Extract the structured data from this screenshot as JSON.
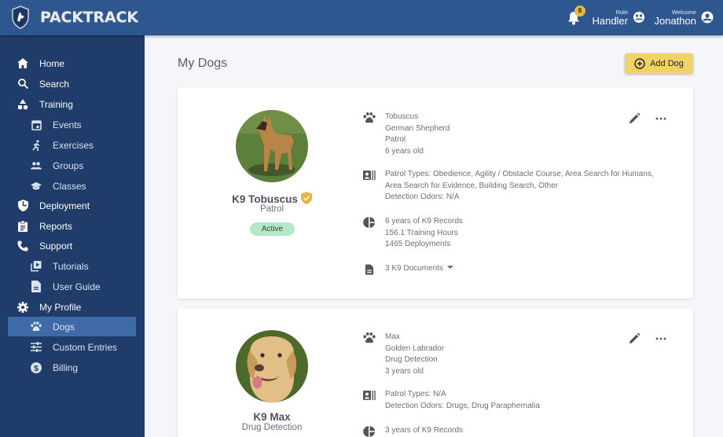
{
  "app": {
    "name": "PACKTRACK",
    "notifications_count": "8",
    "role_label": "Role",
    "role_value": "Handler",
    "welcome_label": "Welcome",
    "user_name": "Jonathon"
  },
  "sidebar": {
    "items": [
      {
        "label": "Home",
        "icon": "home-icon",
        "level": "top"
      },
      {
        "label": "Search",
        "icon": "search-icon",
        "level": "top"
      },
      {
        "label": "Training",
        "icon": "shapes-icon",
        "level": "top"
      },
      {
        "label": "Events",
        "icon": "calendar-icon",
        "level": "sub"
      },
      {
        "label": "Exercises",
        "icon": "running-icon",
        "level": "sub"
      },
      {
        "label": "Groups",
        "icon": "group-icon",
        "level": "sub"
      },
      {
        "label": "Classes",
        "icon": "graduation-cap-icon",
        "level": "sub"
      },
      {
        "label": "Deployment",
        "icon": "shield-icon",
        "level": "top"
      },
      {
        "label": "Reports",
        "icon": "clipboard-icon",
        "level": "top"
      },
      {
        "label": "Support",
        "icon": "phone-icon",
        "level": "top"
      },
      {
        "label": "Tutorials",
        "icon": "video-library-icon",
        "level": "sub"
      },
      {
        "label": "User Guide",
        "icon": "document-icon",
        "level": "sub"
      },
      {
        "label": "My Profile",
        "icon": "gear-icon",
        "level": "top"
      },
      {
        "label": "Dogs",
        "icon": "paw-icon",
        "level": "sub",
        "active": true
      },
      {
        "label": "Custom Entries",
        "icon": "sliders-icon",
        "level": "sub"
      },
      {
        "label": "Billing",
        "icon": "dollar-icon",
        "level": "sub"
      }
    ]
  },
  "main": {
    "title": "My Dogs",
    "add_button": "Add Dog",
    "dogs": [
      {
        "display_name": "K9 Tobuscus",
        "verified": true,
        "role": "Patrol",
        "status": "Active",
        "basic": [
          "Tobuscus",
          "German Shepherd",
          "Patrol",
          "6 years old"
        ],
        "types": [
          "Patrol Types: Obedience, Agility / Obstacle Course, Area Search for Humans,",
          "Area Search for Evidence, Building Search, Other",
          "Detection Odors: N/A"
        ],
        "records": [
          "6 years of K9 Records",
          "156.1 Training Hours",
          "1465 Deployments"
        ],
        "documents": "3 K9 Documents"
      },
      {
        "display_name": "K9 Max",
        "verified": false,
        "role": "Drug Detection",
        "basic": [
          "Max",
          "Golden Labrador",
          "Drug Detection",
          "3 years old"
        ],
        "types": [
          "Patrol Types: N/A",
          "Detection Odors: Drugs, Drug Paraphernalia"
        ],
        "records": [
          "3 years of K9 Records"
        ]
      }
    ]
  },
  "colors": {
    "topbar": "#2e5790",
    "sidebar": "#1f3c6b",
    "sidebar_active": "#3f6aa8",
    "accent_yellow": "#f1d266",
    "status_active": "#b5e8c9",
    "verified_badge": "#e5b640"
  }
}
